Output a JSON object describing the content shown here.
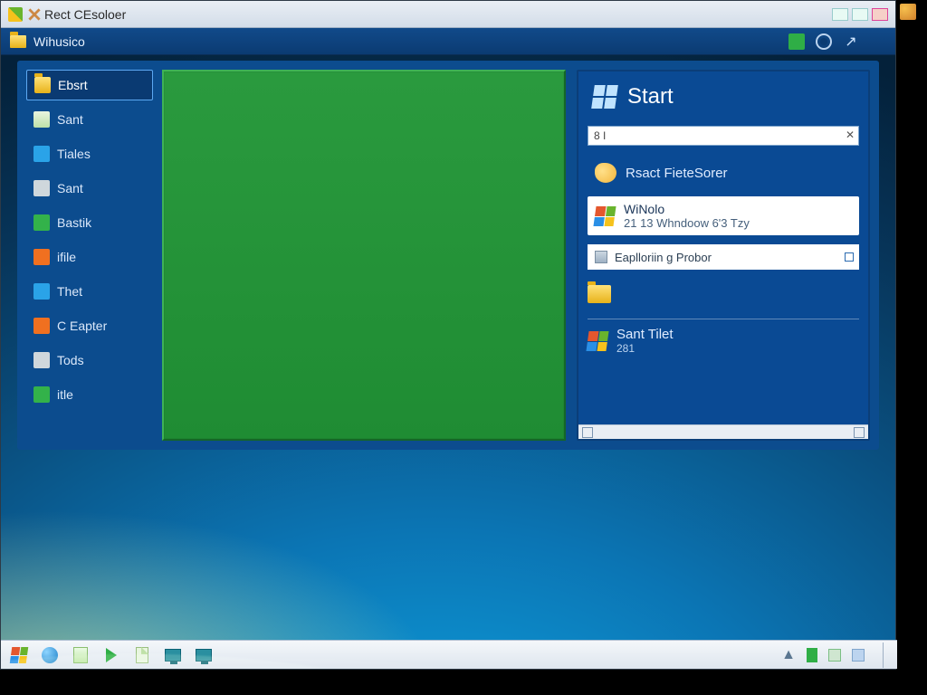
{
  "outer_window": {
    "title": "Rect CEsoloer"
  },
  "toolbar": {
    "breadcrumb": "Wihusico"
  },
  "sidebar": {
    "items": [
      {
        "label": "Ebsrt",
        "icon": "ic-folder",
        "selected": true
      },
      {
        "label": "Sant",
        "icon": "ic-doc"
      },
      {
        "label": "Tiales",
        "icon": "ic-blue"
      },
      {
        "label": "Sant",
        "icon": "ic-grey"
      },
      {
        "label": "Bastik",
        "icon": "ic-green"
      },
      {
        "label": "ifile",
        "icon": "ic-orange"
      },
      {
        "label": "Thet",
        "icon": "ic-blue"
      },
      {
        "label": "C Eapter",
        "icon": "ic-orange"
      },
      {
        "label": "Tods",
        "icon": "ic-grey"
      },
      {
        "label": "itle",
        "icon": "ic-green"
      }
    ]
  },
  "start": {
    "title": "Start",
    "search_placeholder": "8 I",
    "row1": "Rsact FieteSorer",
    "card": {
      "line1": "WiNolo",
      "line2": "21 13 Whndoow  6'3 Tzy"
    },
    "row_white": "Eaplloriin g Probor",
    "bottom": {
      "line1": "Sant Tilet",
      "line2": "281"
    }
  }
}
